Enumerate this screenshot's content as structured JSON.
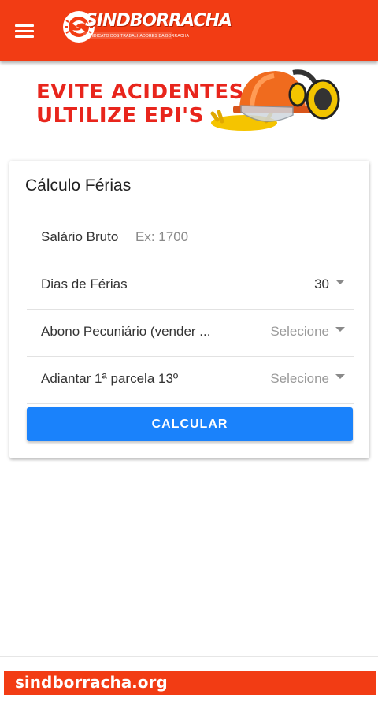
{
  "appbar": {
    "menu_icon": "hamburger-menu-icon",
    "logo_text": "SINDBORRACHA",
    "logo_subtitle": "SINDICATO DOS TRABALHADORES DA BORRACHA"
  },
  "banner": {
    "line1": "EVITE ACIDENTES",
    "line2": "ULTILIZE EPI'S"
  },
  "calc": {
    "title": "Cálculo Férias",
    "salary": {
      "label": "Salário Bruto",
      "placeholder": "Ex: 1700",
      "value": ""
    },
    "days": {
      "label": "Dias de Férias",
      "value": "30"
    },
    "abono": {
      "label": "Abono Pecuniário (vender ...",
      "value": "Selecione"
    },
    "adiantar": {
      "label": "Adiantar 1ª parcela 13º",
      "value": "Selecione"
    },
    "button_label": "CALCULAR"
  },
  "footer": {
    "text": "sindborracha.org"
  },
  "colors": {
    "brand": "#f23c14",
    "button": "#1a82fb",
    "banner_text": "#e8251c"
  }
}
